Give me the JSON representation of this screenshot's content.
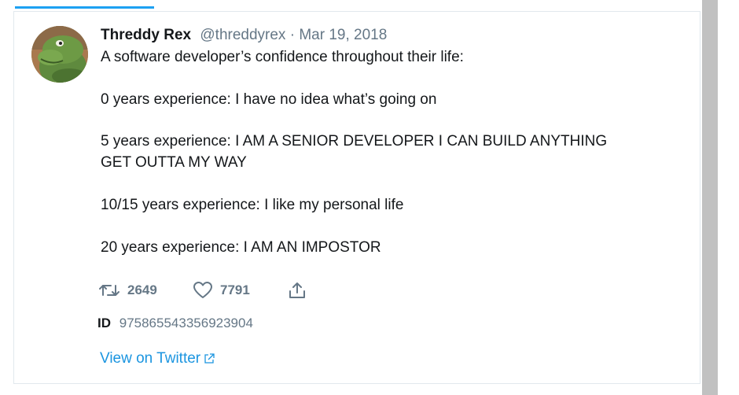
{
  "tweet": {
    "author_name": "Threddy Rex",
    "handle": "@threddyrex",
    "separator": "·",
    "date": "Mar 19, 2018",
    "lines": [
      "A software developer’s confidence throughout their life:",
      "0 years experience: I have no idea what’s going on",
      "5 years experience: I AM A SENIOR DEVELOPER I CAN BUILD ANYTHING",
      "GET OUTTA MY WAY",
      "10/15 years experience: I like my personal life",
      "20 years experience: I AM AN IMPOSTOR"
    ],
    "retweets": "2649",
    "likes": "7791",
    "id_label": "ID",
    "id_value": "975865543356923904",
    "view_link": "View on Twitter"
  },
  "icons": {
    "retweet": "retweet-icon",
    "like": "heart-icon",
    "share": "share-icon",
    "external": "external-link-icon"
  },
  "colors": {
    "accent": "#1da1f2",
    "link": "#1b95e0",
    "muted": "#657786",
    "text": "#14171a",
    "border": "#e1e8ed"
  }
}
